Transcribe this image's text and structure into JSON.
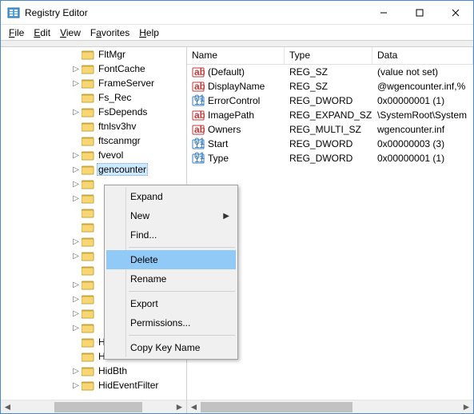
{
  "window": {
    "title": "Registry Editor"
  },
  "menu": {
    "file": "File",
    "edit": "Edit",
    "view": "View",
    "favorites": "Favorites",
    "help": "Help"
  },
  "tree": {
    "items": [
      {
        "label": "FltMgr",
        "expander": ""
      },
      {
        "label": "FontCache",
        "expander": ">"
      },
      {
        "label": "FrameServer",
        "expander": ">"
      },
      {
        "label": "Fs_Rec",
        "expander": ""
      },
      {
        "label": "FsDepends",
        "expander": ">"
      },
      {
        "label": "ftnlsv3hv",
        "expander": ""
      },
      {
        "label": "ftscanmgr",
        "expander": ""
      },
      {
        "label": "fvevol",
        "expander": ">"
      },
      {
        "label": "gencounter",
        "expander": ">",
        "selected": true
      },
      {
        "label": "",
        "expander": ">"
      },
      {
        "label": "",
        "expander": ">"
      },
      {
        "label": "",
        "expander": ""
      },
      {
        "label": "",
        "expander": ""
      },
      {
        "label": "",
        "expander": ">"
      },
      {
        "label": "",
        "expander": ">"
      },
      {
        "label": "",
        "expander": ""
      },
      {
        "label": "",
        "expander": ">"
      },
      {
        "label": "",
        "expander": ">"
      },
      {
        "label": "",
        "expander": ">"
      },
      {
        "label": "",
        "expander": ">"
      },
      {
        "label": "HID_PCI",
        "expander": ""
      },
      {
        "label": "HidBatt",
        "expander": ""
      },
      {
        "label": "HidBth",
        "expander": ">"
      },
      {
        "label": "HidEventFilter",
        "expander": ">"
      }
    ]
  },
  "list": {
    "headers": {
      "name": "Name",
      "type": "Type",
      "data": "Data"
    },
    "rows": [
      {
        "icon": "str",
        "name": "(Default)",
        "type": "REG_SZ",
        "data": "(value not set)"
      },
      {
        "icon": "str",
        "name": "DisplayName",
        "type": "REG_SZ",
        "data": "@wgencounter.inf,%"
      },
      {
        "icon": "bin",
        "name": "ErrorControl",
        "type": "REG_DWORD",
        "data": "0x00000001 (1)"
      },
      {
        "icon": "str",
        "name": "ImagePath",
        "type": "REG_EXPAND_SZ",
        "data": "\\SystemRoot\\System"
      },
      {
        "icon": "str",
        "name": "Owners",
        "type": "REG_MULTI_SZ",
        "data": "wgencounter.inf"
      },
      {
        "icon": "bin",
        "name": "Start",
        "type": "REG_DWORD",
        "data": "0x00000003 (3)"
      },
      {
        "icon": "bin",
        "name": "Type",
        "type": "REG_DWORD",
        "data": "0x00000001 (1)"
      }
    ]
  },
  "context": {
    "expand": "Expand",
    "new": "New",
    "find": "Find...",
    "delete": "Delete",
    "rename": "Rename",
    "export": "Export",
    "permissions": "Permissions...",
    "copykey": "Copy Key Name"
  }
}
